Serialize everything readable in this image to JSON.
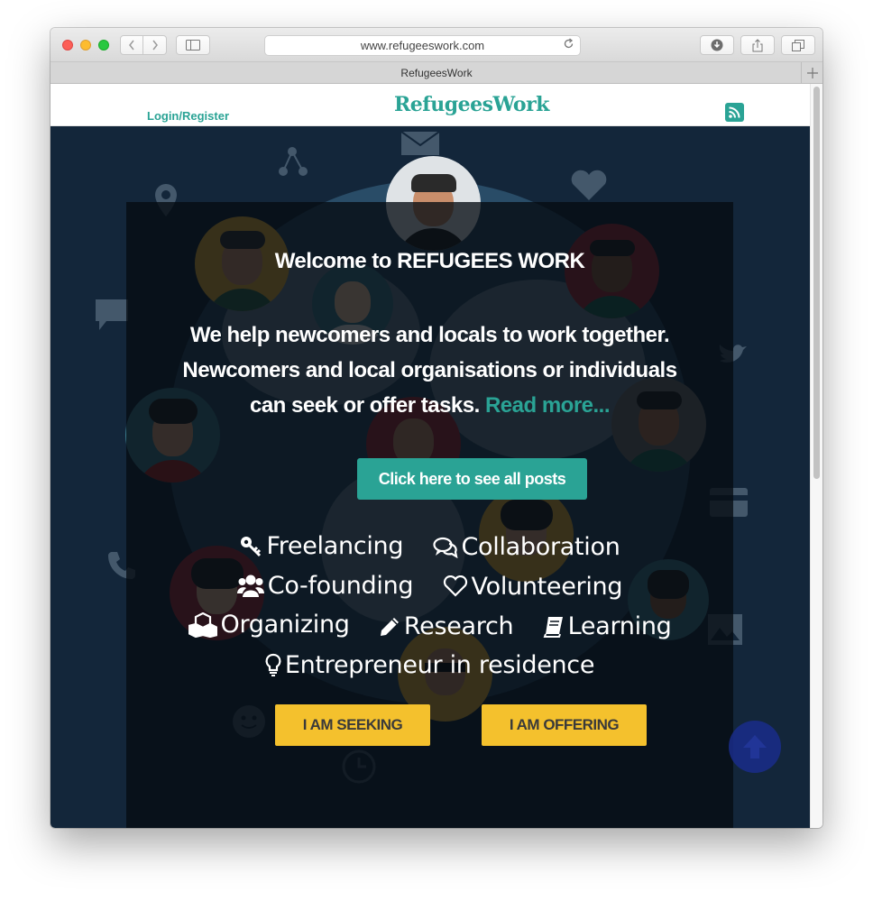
{
  "browser": {
    "url": "www.refugeeswork.com",
    "tab_title": "RefugeesWork"
  },
  "header": {
    "login_label": "Login/Register",
    "logo_text": "RefugeesWork",
    "rss_icon": "rss-icon"
  },
  "hero": {
    "welcome": "Welcome to REFUGEES WORK",
    "tagline_line1": "We help newcomers and locals to work together.",
    "tagline_line2": "Newcomers and local organisations or individuals",
    "tagline_line3": "can seek or offer tasks.",
    "read_more": "Read more...",
    "posts_button": "Click here to see all posts",
    "categories": [
      {
        "label": "Freelancing",
        "icon": "key-icon"
      },
      {
        "label": "Collaboration",
        "icon": "chat-icon"
      },
      {
        "label": "Co-founding",
        "icon": "users-icon"
      },
      {
        "label": "Volunteering",
        "icon": "heart-icon"
      },
      {
        "label": "Organizing",
        "icon": "cubes-icon"
      },
      {
        "label": "Research",
        "icon": "pencil-icon"
      },
      {
        "label": "Learning",
        "icon": "book-icon"
      },
      {
        "label": "Entrepreneur in residence",
        "icon": "lightbulb-icon"
      }
    ],
    "seek_button": "I AM SEEKING",
    "offer_button": "I AM OFFERING"
  },
  "colors": {
    "accent": "#2aa395",
    "cta": "#f4c12d",
    "hero_bg": "#13263a"
  }
}
